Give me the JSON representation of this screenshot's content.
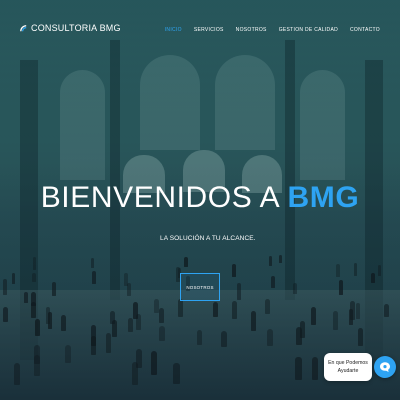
{
  "brand": {
    "name": "CONSULTORIA BMG",
    "icon": "signal-arc-icon"
  },
  "nav": {
    "items": [
      {
        "label": "INICIO",
        "active": true
      },
      {
        "label": "SERVICIOS",
        "active": false
      },
      {
        "label": "NOSOTROS",
        "active": false
      },
      {
        "label": "GESTION DE CALIDAD",
        "active": false
      },
      {
        "label": "CONTACTO",
        "active": false
      }
    ]
  },
  "hero": {
    "headline_prefix": "BIENVENIDOS A ",
    "headline_accent": "BMG",
    "subtitle": "LA SOLUCIÓN A TU ALCANCE.",
    "cta_label": "NOSOTROS"
  },
  "chat": {
    "line1": "En que Podemos",
    "line2": "Ayudarte",
    "icon": "chat-icon"
  },
  "colors": {
    "accent": "#2ea3f2",
    "text": "#ffffff",
    "overlay": "#2f5a60"
  }
}
